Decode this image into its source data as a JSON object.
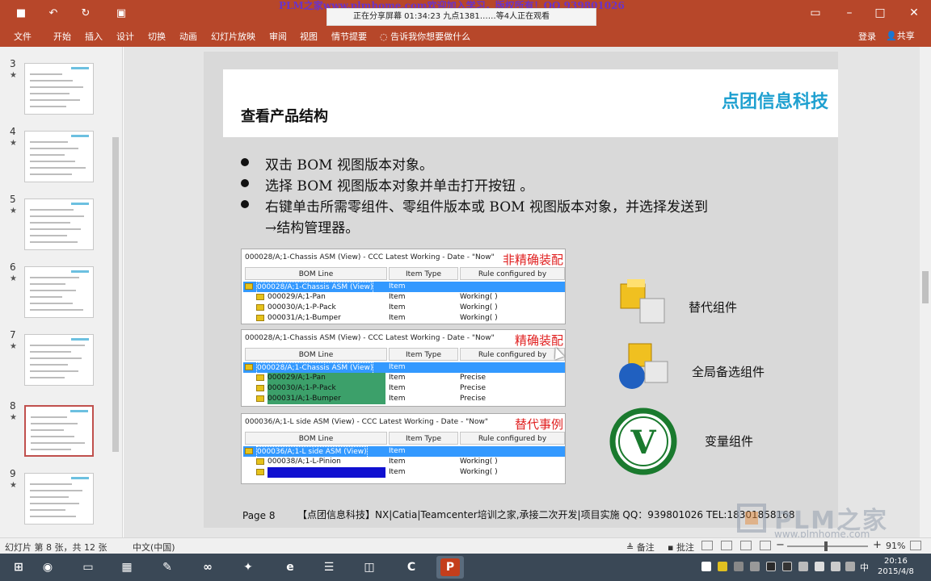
{
  "window": {
    "banner": "PLM之家www.plmhome.com欢迎加入学习，版权所有！QQ 939801026",
    "share_status": "正在分享屏幕    01:34:23    九点1381……等4人正在观看",
    "min_icon": "minimize-icon",
    "max_icon": "maximize-icon",
    "close_icon": "close-icon"
  },
  "quick_access": [
    {
      "name": "save-icon",
      "glyph": "💾"
    },
    {
      "name": "undo-icon",
      "glyph": "↶"
    },
    {
      "name": "redo-icon",
      "glyph": "↻"
    },
    {
      "name": "present-icon",
      "glyph": "▣"
    }
  ],
  "ribbon": {
    "tabs": [
      "文件",
      "开始",
      "插入",
      "设计",
      "切换",
      "动画",
      "幻灯片放映",
      "审阅",
      "视图",
      "情节提要"
    ],
    "tell_me": "告诉我你想要做什么",
    "login": "登录",
    "share": "共享"
  },
  "thumbnails": [
    {
      "num": "3",
      "star": "★",
      "selected": false
    },
    {
      "num": "4",
      "star": "★",
      "selected": false
    },
    {
      "num": "5",
      "star": "★",
      "selected": false
    },
    {
      "num": "6",
      "star": "★",
      "selected": false
    },
    {
      "num": "7",
      "star": "★",
      "selected": false
    },
    {
      "num": "8",
      "star": "★",
      "selected": true
    },
    {
      "num": "9",
      "star": "★",
      "selected": false
    }
  ],
  "slide": {
    "title": "查看产品结构",
    "brand": "点团信息科技",
    "bullets": [
      "双击 BOM 视图版本对象。",
      "选择 BOM 视图版本对象并单击打开按钮 。",
      "右键单击所需零组件、零组件版本或 BOM 视图版本对象，并选择发送到",
      "→结构管理器。"
    ],
    "panels": [
      {
        "header": "000028/A;1-Chassis ASM (View) - CCC Latest Working - Date - \"Now\"",
        "tag": "非精确装配",
        "columns": [
          "BOM Line",
          "Item Type",
          "Rule configured by"
        ],
        "rows": [
          {
            "line": "000028/A;1-Chassis ASM (View)",
            "type": "Item",
            "rule": "",
            "selected": true
          },
          {
            "line": "000029/A;1-Pan",
            "type": "Item",
            "rule": "Working( )"
          },
          {
            "line": "000030/A;1-P-Pack",
            "type": "Item",
            "rule": "Working( )"
          },
          {
            "line": "000031/A;1-Bumper",
            "type": "Item",
            "rule": "Working( )"
          }
        ]
      },
      {
        "header": "000028/A;1-Chassis ASM (View) - CCC Latest Working - Date - \"Now\"",
        "tag": "精确装配",
        "columns": [
          "BOM Line",
          "Item Type",
          "Rule configured by"
        ],
        "rows": [
          {
            "line": "000028/A;1-Chassis ASM (View)",
            "type": "Item",
            "rule": "",
            "selected": true
          },
          {
            "line": "000029/A;1-Pan",
            "type": "Item",
            "rule": "Precise",
            "green": true
          },
          {
            "line": "000030/A;1-P-Pack",
            "type": "Item",
            "rule": "Precise",
            "green": true
          },
          {
            "line": "000031/A;1-Bumper",
            "type": "Item",
            "rule": "Precise",
            "green": true
          }
        ]
      },
      {
        "header": "000036/A;1-L side ASM (View) - CCC Latest Working - Date - \"Now\"",
        "tag": "替代事例",
        "columns": [
          "BOM Line",
          "Item Type",
          "Rule configured by"
        ],
        "rows": [
          {
            "line": "000036/A;1-L side ASM (View)",
            "type": "Item",
            "rule": "",
            "selected": true
          },
          {
            "line": "000038/A;1-L-Pinion",
            "type": "Item",
            "rule": "Working( )"
          },
          {
            "line": "",
            "type": "Item",
            "rule": "Working( )",
            "blue": true
          }
        ]
      }
    ],
    "icon_labels": [
      "替代组件",
      "全局备选组件",
      "变量组件"
    ],
    "page_label": "Page 8",
    "footer": "【点团信息科技】NX|Catia|Teamcenter培训之家,承接二次开发|项目实施 QQ：939801026 TEL:18301858168"
  },
  "statusbar": {
    "slide_info": "幻灯片 第 8 张，共 12 张",
    "language": "中文(中国)",
    "notes": "备注",
    "comments": "批注",
    "zoom": "91%"
  },
  "taskbar": {
    "apps": [
      {
        "name": "start-icon",
        "glyph": "⊞",
        "color": "#3a4856"
      },
      {
        "name": "browser-360-icon",
        "glyph": "◉",
        "color": "#3a4856"
      },
      {
        "name": "file-explorer-icon",
        "glyph": "▭",
        "color": "#3a4856"
      },
      {
        "name": "store-icon",
        "glyph": "▦",
        "color": "#3a4856"
      },
      {
        "name": "notepad-icon",
        "glyph": "✎",
        "color": "#3a4856"
      },
      {
        "name": "visual-studio-icon",
        "glyph": "∞",
        "color": "#3a4856"
      },
      {
        "name": "paint-icon",
        "glyph": "✦",
        "color": "#3a4856"
      },
      {
        "name": "ie-icon",
        "glyph": "e",
        "color": "#3a4856"
      },
      {
        "name": "chat-icon",
        "glyph": "☰",
        "color": "#3a4856"
      },
      {
        "name": "virtualbox-icon",
        "glyph": "◫",
        "color": "#3a4856"
      },
      {
        "name": "camtasia-icon",
        "glyph": "C",
        "color": "#3a4856"
      },
      {
        "name": "powerpoint-icon",
        "glyph": "P",
        "color": "#c43e1c"
      }
    ],
    "tray_lang": "中",
    "time": "20:16",
    "date": "2015/4/8"
  },
  "watermark": {
    "text": "PLM之家",
    "sub": "www.plmhome.com"
  }
}
